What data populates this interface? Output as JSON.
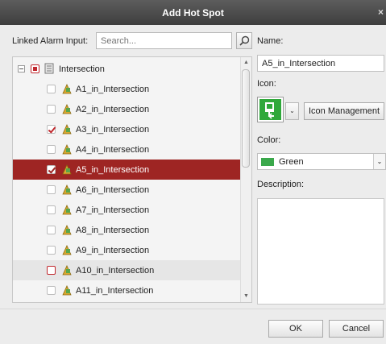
{
  "dialog": {
    "title": "Add Hot Spot",
    "close_glyph": "×"
  },
  "left": {
    "linked_label": "Linked Alarm Input:",
    "search_placeholder": "Search...",
    "tree": {
      "root": {
        "label": "Intersection",
        "state": "partial"
      },
      "items": [
        {
          "label": "A1_in_Intersection",
          "checked": false,
          "selected": false
        },
        {
          "label": "A2_in_Intersection",
          "checked": false,
          "selected": false
        },
        {
          "label": "A3_in_Intersection",
          "checked": true,
          "selected": false
        },
        {
          "label": "A4_in_Intersection",
          "checked": false,
          "selected": false
        },
        {
          "label": "A5_in_Intersection",
          "checked": true,
          "selected": true
        },
        {
          "label": "A6_in_Intersection",
          "checked": false,
          "selected": false
        },
        {
          "label": "A7_in_Intersection",
          "checked": false,
          "selected": false
        },
        {
          "label": "A8_in_Intersection",
          "checked": false,
          "selected": false
        },
        {
          "label": "A9_in_Intersection",
          "checked": false,
          "selected": false
        },
        {
          "label": "A10_in_Intersection",
          "checked": false,
          "selected": false,
          "hover": true
        },
        {
          "label": "A11_in_Intersection",
          "checked": false,
          "selected": false
        }
      ]
    }
  },
  "right": {
    "name_label": "Name:",
    "name_value": "A5_in_Intersection",
    "icon_label": "Icon:",
    "icon_management": "Icon Management",
    "color_label": "Color:",
    "color_value": "Green",
    "color_hex": "#3aa84b",
    "description_label": "Description:"
  },
  "footer": {
    "ok": "OK",
    "cancel": "Cancel"
  },
  "colors": {
    "accent": "#9e2523",
    "check": "#c0272d",
    "titlebar": "#4a4a4a"
  },
  "icons": [
    "search-icon",
    "alarm-input-icon",
    "intersection-icon",
    "hotspot-icon",
    "chevron-down-icon",
    "close-icon"
  ]
}
